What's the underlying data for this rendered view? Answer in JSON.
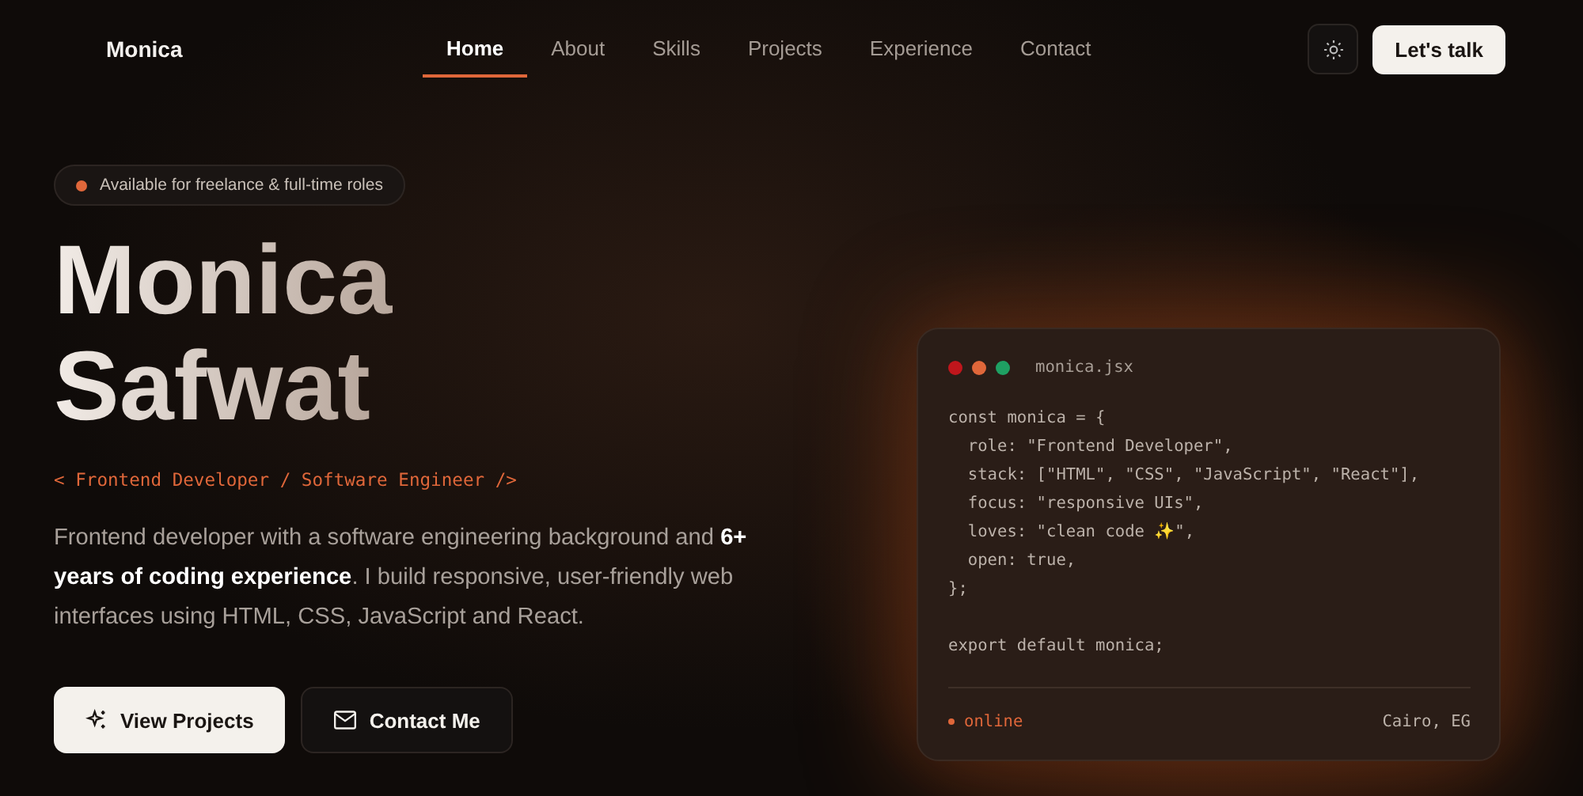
{
  "header": {
    "logo": "Monica",
    "nav": [
      {
        "label": "Home",
        "selected": true
      },
      {
        "label": "About",
        "selected": false
      },
      {
        "label": "Skills",
        "selected": false
      },
      {
        "label": "Projects",
        "selected": false
      },
      {
        "label": "Experience",
        "selected": false
      },
      {
        "label": "Contact",
        "selected": false
      }
    ],
    "cta": "Let's talk"
  },
  "hero": {
    "badge": "Available for freelance & full-time roles",
    "name_lines": [
      "Monica",
      "Safwat"
    ],
    "role": "< Frontend Developer / Software Engineer />",
    "intro": "Frontend developer with a software engineering background and **6+ years of coding experience**. I build responsive, user-friendly web interfaces using HTML, CSS, JavaScript and React.",
    "buttons": [
      {
        "label": "View Projects",
        "kind": "primary"
      },
      {
        "label": "Contact Me",
        "kind": "secondary"
      }
    ]
  },
  "code_card": {
    "dots": [
      {
        "color": "#c0161c"
      },
      {
        "color": "#e0673a"
      },
      {
        "color": "#1fa063"
      }
    ],
    "filename": "monica.jsx",
    "blocks": [
      [
        "const monica = {",
        "  role: \"Frontend Developer\",",
        "  stack: [\"HTML\", \"CSS\", \"JavaScript\", \"React\"],",
        "  focus: \"responsive UIs\",",
        "  loves: \"clean code ✨\",",
        "  open: true,",
        "};"
      ],
      [
        "export default monica;"
      ]
    ],
    "status": "online",
    "location": "Cairo, EG"
  }
}
